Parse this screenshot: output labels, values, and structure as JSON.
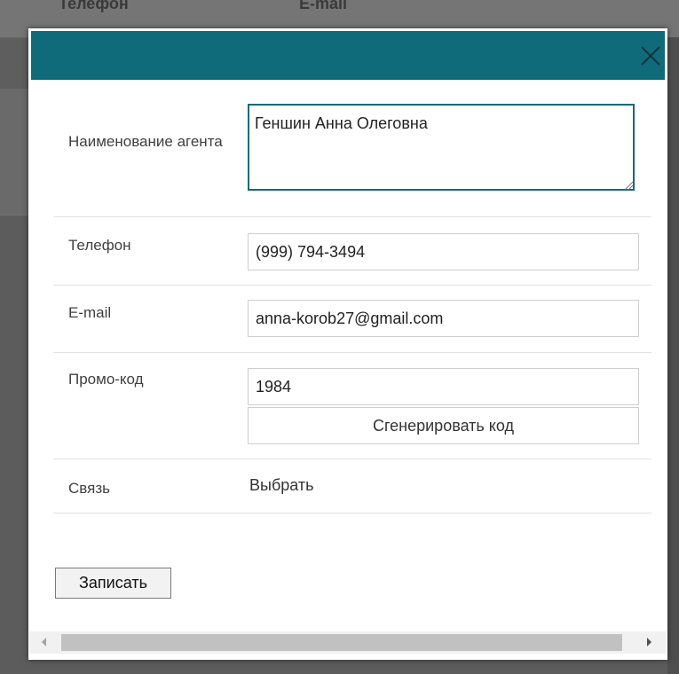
{
  "background": {
    "header_cols": [
      "Телефон",
      "E-mail"
    ]
  },
  "dialog": {
    "fields": {
      "agent_name": {
        "label": "Наименование агента",
        "value": "Геншин Анна Олеговна"
      },
      "phone": {
        "label": "Телефон",
        "value": "(999) 794-3494"
      },
      "email": {
        "label": "E-mail",
        "value": "anna-korob27@gmail.com"
      },
      "promo": {
        "label": "Промо-код",
        "value": "1984",
        "generate_label": "Сгенерировать код"
      },
      "link": {
        "label": "Связь",
        "value": "Выбрать"
      }
    },
    "save_label": "Записать"
  },
  "colors": {
    "titlebar": "#0f6b7a",
    "overlay": "#5c5c5c"
  },
  "icons": {
    "close": "close-icon",
    "resize": "resize-grip-icon"
  }
}
